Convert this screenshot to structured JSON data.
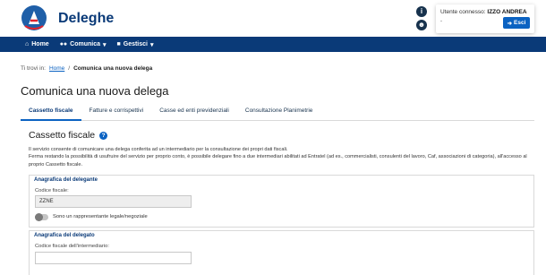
{
  "header": {
    "app_title": "Deleghe",
    "info_icon": "info-icon",
    "accessibility_icon": "accessibility-icon",
    "user_label": "Utente connesso:",
    "user_name": "IZZO ANDREA",
    "user_extra": "-",
    "exit_label": "Esci"
  },
  "nav": {
    "items": [
      {
        "label": "Home",
        "icon": "home-icon"
      },
      {
        "label": "Comunica",
        "icon": "users-icon"
      },
      {
        "label": "Gestisci",
        "icon": "gear-icon"
      }
    ]
  },
  "breadcrumb": {
    "prefix": "Ti trovi in:",
    "home": "Home",
    "separator": "/",
    "current": "Comunica una nuova delega"
  },
  "page": {
    "title": "Comunica una nuova delega"
  },
  "tabs": [
    {
      "label": "Cassetto fiscale",
      "active": true
    },
    {
      "label": "Fatture e corrispettivi",
      "active": false
    },
    {
      "label": "Casse ed enti previdenziali",
      "active": false
    },
    {
      "label": "Consultazione Planimetrie",
      "active": false
    }
  ],
  "section": {
    "title": "Cassetto fiscale",
    "desc_line1": "Il servizio consente di comunicare una delega conferita ad un intermediario per la consultazione dei propri dati fiscali.",
    "desc_line2": "Ferma restando la possibilità di usufruire del servizio per proprio conto, è possibile delegare fino a due intermediari abilitati ad Entratel (ad es., commercialisti, consulenti del lavoro, Caf, associazioni di categoria), all'accesso al proprio Cassetto fiscale."
  },
  "delegante": {
    "legend": "Anagrafica del delegante",
    "cf_label": "Codice fiscale:",
    "cf_value": "ZZNE",
    "toggle_label": "Sono un rappresentante legale/negoziale"
  },
  "delegato": {
    "legend": "Anagrafica del delegato",
    "cf_label": "Codice fiscale dell'intermediario:",
    "cf_value": ""
  },
  "colors": {
    "brand_blue": "#0a3a78",
    "accent_blue": "#0b62c2"
  }
}
